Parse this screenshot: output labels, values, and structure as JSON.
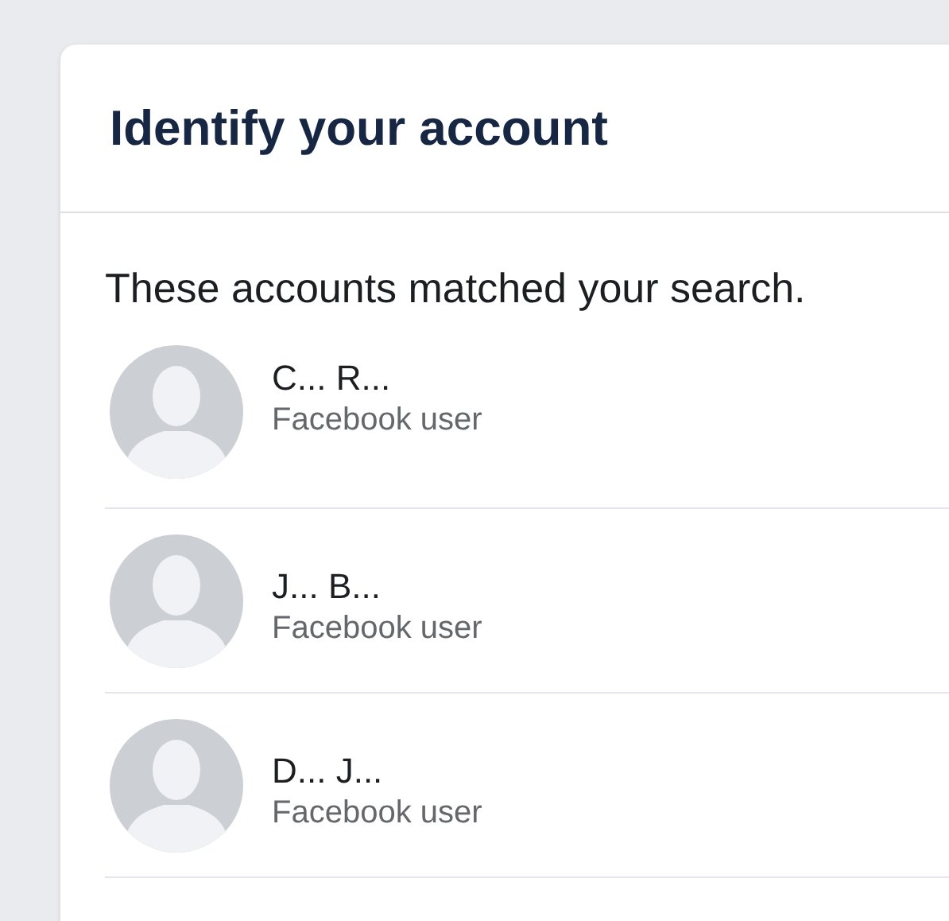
{
  "card": {
    "title": "Identify your account",
    "intro": "These accounts matched your search.",
    "accounts": [
      {
        "name": "C... R...",
        "subtitle": "Facebook user"
      },
      {
        "name": "J... B...",
        "subtitle": "Facebook user"
      },
      {
        "name": "D... J...",
        "subtitle": "Facebook user"
      }
    ]
  }
}
